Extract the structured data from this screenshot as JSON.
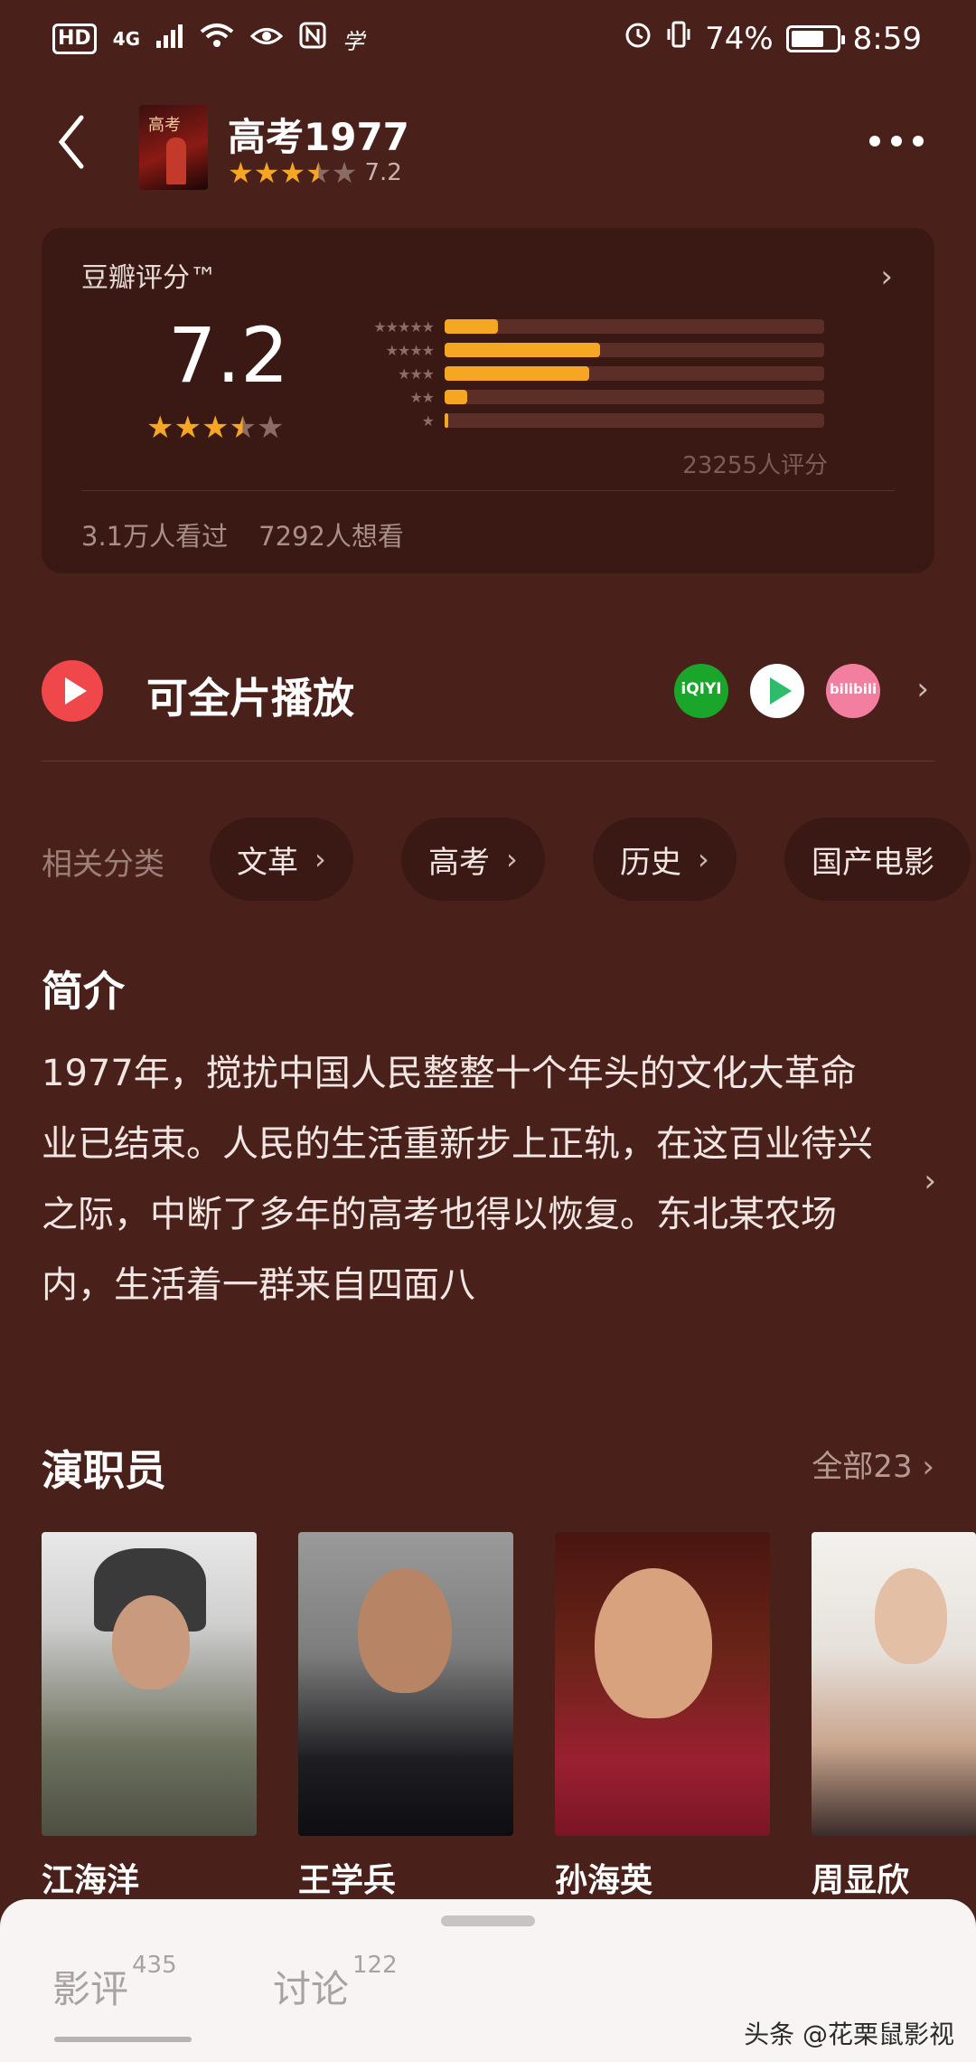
{
  "status_bar": {
    "network_hd": "HD",
    "network_4g": "4G",
    "battery_percent": "74%",
    "battery_level": 0.74,
    "time": "8:59"
  },
  "header": {
    "title": "高考1977",
    "rating": "7.2",
    "stars_filled": 3.5
  },
  "rating_card": {
    "label": "豆瓣评分™",
    "score": "7.2",
    "distribution": [
      {
        "stars": "★★★★★",
        "fraction": 0.14
      },
      {
        "stars": "★★★★",
        "fraction": 0.41
      },
      {
        "stars": "★★★",
        "fraction": 0.38
      },
      {
        "stars": "★★",
        "fraction": 0.06
      },
      {
        "stars": "★",
        "fraction": 0.01
      }
    ],
    "rating_count": "23255人评分",
    "watched": "3.1万人看过",
    "want_to_watch": "7292人想看"
  },
  "play": {
    "label": "可全片播放",
    "platforms": [
      "iQIYI",
      "bilibili"
    ]
  },
  "categories": {
    "label": "相关分类",
    "items": [
      "文革",
      "高考",
      "历史",
      "国产电影"
    ]
  },
  "synopsis": {
    "title": "简介",
    "text": "1977年，搅扰中国人民整整十个年头的文化大革命业已结束。人民的生活重新步上正轨，在这百业待兴之际，中断了多年的高考也得以恢复。东北某农场内，生活着一群来自四面八"
  },
  "cast": {
    "title": "演职员",
    "all_label": "全部23",
    "members": [
      {
        "name": "江海洋"
      },
      {
        "name": "王学兵"
      },
      {
        "name": "孙海英"
      },
      {
        "name": "周显欣"
      }
    ]
  },
  "bottom_tabs": {
    "reviews_label": "影评",
    "reviews_count": "435",
    "discussion_label": "讨论",
    "discussion_count": "122"
  },
  "watermark": "头条 @花栗鼠影视",
  "colors": {
    "background": "#4a211a",
    "card": "#3a1813",
    "star": "#f5a623",
    "play_button": "#f0474a"
  }
}
